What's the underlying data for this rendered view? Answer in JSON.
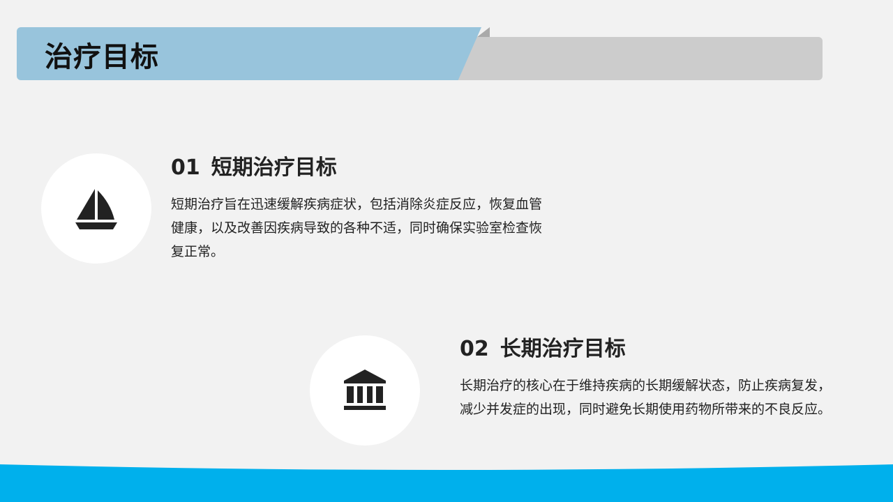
{
  "header": {
    "title": "治疗目标"
  },
  "goals": [
    {
      "number": "01",
      "title": "短期治疗目标",
      "description": "短期治疗旨在迅速缓解疾病症状，包括消除炎症反应，恢复血管健康，以及改善因疾病导致的各种不适，同时确保实验室检查恢复正常。",
      "icon": "sailboat-icon"
    },
    {
      "number": "02",
      "title": "长期治疗目标",
      "description": "长期治疗的核心在于维持疾病的长期缓解状态，防止疾病复发，减少并发症的出现，同时避免长期使用药物所带来的不良反应。",
      "icon": "bank-building-icon"
    }
  ],
  "colors": {
    "background": "#f2f2f2",
    "header_blue": "#98c4dc",
    "header_grey": "#cccccc",
    "bottom_band": "#00b0ec",
    "text": "#222222"
  }
}
